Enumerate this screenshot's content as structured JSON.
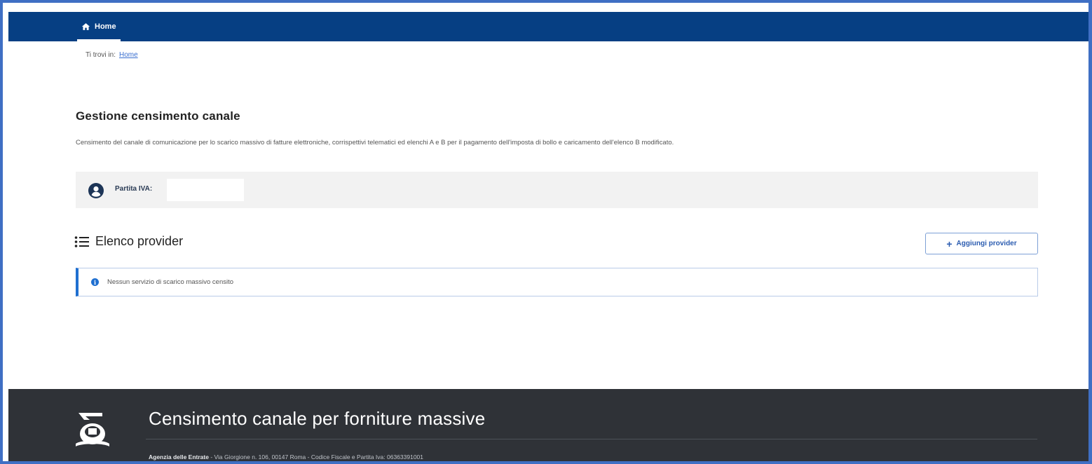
{
  "nav": {
    "home_label": "Home",
    "home_icon": "home-icon"
  },
  "breadcrumb": {
    "prefix": "Ti trovi in:",
    "current": "Home"
  },
  "page": {
    "title": "Gestione censimento canale",
    "description": "Censimento del canale di comunicazione per lo scarico massivo di fatture elettroniche, corrispettivi telematici ed elenchi A e B per il pagamento dell'imposta di bollo e caricamento dell'elenco B modificato."
  },
  "piva": {
    "label": "Partita IVA:",
    "value": "",
    "icon": "user-circle-icon"
  },
  "providers": {
    "heading": "Elenco provider",
    "heading_icon": "list-icon",
    "add_button_label": "Aggiungi provider",
    "add_icon": "plus-icon",
    "empty_message": "Nessun servizio di scarico massivo censito",
    "info_icon": "info-icon"
  },
  "footer": {
    "title": "Censimento canale per forniture massive",
    "org_name": "Agenzia delle Entrate",
    "address": " - Via Giorgione n. 106, 00147 Roma - Codice Fiscale e Partita Iva: 06363391001",
    "logo_icon": "agenzia-logo-icon"
  },
  "colors": {
    "nav_bg": "#063f83",
    "accent": "#1f6fd0",
    "footer_bg": "#2f3237",
    "frame_border": "#3f6fc4"
  }
}
